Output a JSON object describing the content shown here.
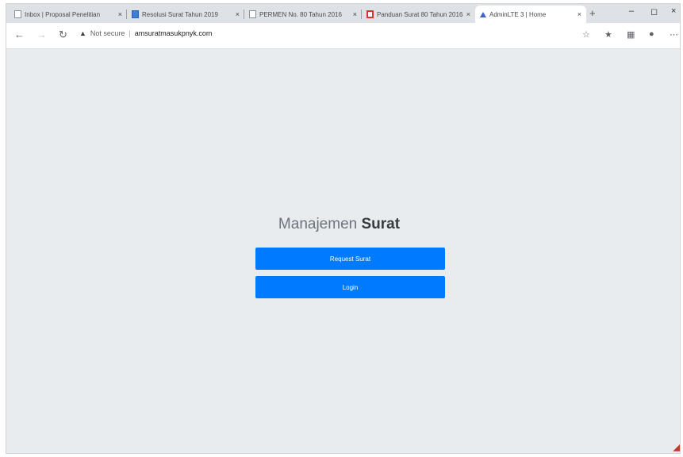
{
  "browser": {
    "tabs": [
      {
        "title": "Inbox | Proposal Penelitian",
        "icon": "page-icon"
      },
      {
        "title": "Resolusi Surat Tahun 2019",
        "icon": "doc-blue-icon"
      },
      {
        "title": "PERMEN No. 80 Tahun 2016",
        "icon": "page-icon"
      },
      {
        "title": "Panduan Surat 80 Tahun 2016",
        "icon": "bookmark-red-icon"
      },
      {
        "title": "AdminLTE 3 | Home",
        "icon": "app-icon"
      }
    ],
    "new_tab_symbol": "+",
    "window_controls": {
      "minimize": "–",
      "restore": "◻",
      "close": "×"
    },
    "nav": {
      "back": "←",
      "forward": "→",
      "reload": "↻"
    },
    "address": {
      "security": "Not secure",
      "url": "amsuratmasukpnyk.com"
    }
  },
  "page": {
    "title_light": "Manajemen",
    "title_bold": "Surat",
    "buttons": {
      "request": "Request Surat",
      "login": "Login"
    }
  },
  "colors": {
    "primary": "#007bff",
    "background": "#e9ecef"
  }
}
